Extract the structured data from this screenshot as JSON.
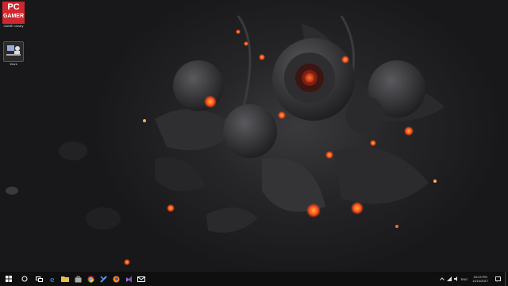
{
  "desktop": {
    "icons": [
      {
        "name": "PC Gamer",
        "line1": "PC",
        "line2": "GAMER",
        "label": "GAME Library",
        "icon": "pc-gamer-logo-icon"
      },
      {
        "name": "Work",
        "label": "Work",
        "icon": "work-folder-icon"
      }
    ]
  },
  "taskbar": {
    "start_icon": "windows-start-icon",
    "search_icon": "search-icon",
    "taskview_icon": "task-view-icon",
    "pinned": [
      {
        "name": "edge",
        "icon": "edge-icon",
        "color": "#3aa0e8"
      },
      {
        "name": "explorer",
        "icon": "file-explorer-icon",
        "color": "#e8c14b"
      },
      {
        "name": "store",
        "icon": "store-icon",
        "color": "#aaaaaa"
      },
      {
        "name": "chrome",
        "icon": "chrome-icon",
        "color": "#dddddd"
      },
      {
        "name": "app",
        "icon": "app-icon",
        "color": "#4aa0ff"
      },
      {
        "name": "firefox",
        "icon": "firefox-icon",
        "color": "#ff8a1c"
      },
      {
        "name": "visual-studio",
        "icon": "visual-studio-icon",
        "color": "#9b6fd8"
      },
      {
        "name": "mail",
        "icon": "mail-icon",
        "color": "#ffffff"
      }
    ],
    "tray": {
      "lang": "ENG",
      "time": "04:23 PM",
      "date": "11/10/2017"
    }
  },
  "colors": {
    "ember": "#ff5a1e",
    "ember_core": "#ffb04a",
    "taskbar": "#0f0f10"
  }
}
